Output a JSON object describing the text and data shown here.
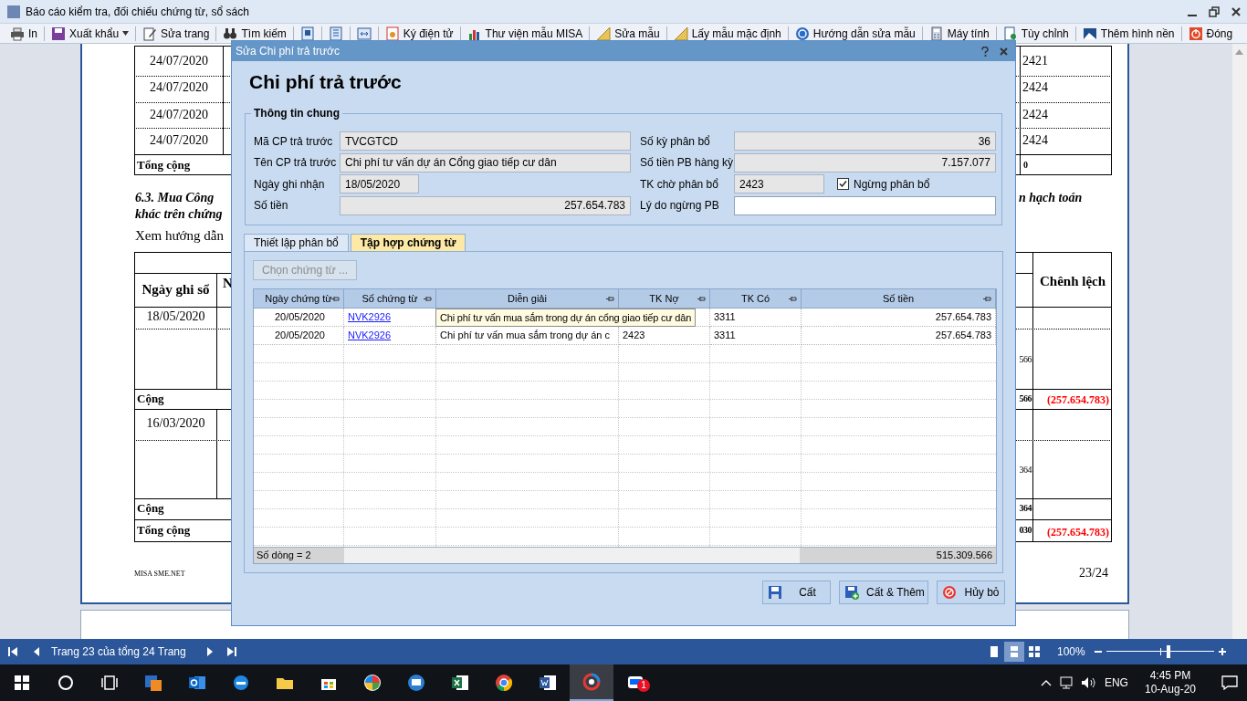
{
  "window": {
    "title": "Báo cáo kiểm tra, đối chiếu chứng từ, sổ sách"
  },
  "toolbar": [
    {
      "kind": "print",
      "label": "In",
      "dropdown": false
    },
    {
      "kind": "export",
      "label": "Xuất khẩu",
      "dropdown": true
    },
    {
      "kind": "edit",
      "label": "Sửa trang",
      "dropdown": false
    },
    {
      "kind": "find",
      "label": "Tìm kiếm",
      "dropdown": false
    },
    {
      "kind": "page-single",
      "dropdown": false
    },
    {
      "kind": "page-double",
      "dropdown": false
    },
    {
      "kind": "page-fit",
      "dropdown": false
    },
    {
      "kind": "sign",
      "label": "Ký điện tử",
      "dropdown": false
    },
    {
      "kind": "library",
      "label": "Thư viện mẫu MISA",
      "dropdown": false
    },
    {
      "kind": "template",
      "label": "Sửa mẫu",
      "dropdown": false
    },
    {
      "kind": "template",
      "label": "Lấy mẫu mặc định",
      "dropdown": false
    },
    {
      "kind": "help",
      "label": "Hướng dẫn sửa mẫu",
      "dropdown": false
    },
    {
      "kind": "calculator",
      "label": "Máy tính",
      "dropdown": false
    },
    {
      "kind": "customize",
      "label": "Tùy chỉnh",
      "dropdown": false
    },
    {
      "kind": "wallpaper",
      "label": "Thêm hình nền",
      "dropdown": false
    },
    {
      "kind": "close",
      "label": "Đóng",
      "dropdown": false
    }
  ],
  "document": {
    "left": [
      {
        "kind": "cell",
        "text": "24/07/2020"
      },
      {
        "kind": "cell",
        "text": "24/07/2020"
      },
      {
        "kind": "cell",
        "text": "24/07/2020"
      },
      {
        "kind": "cell",
        "text": "24/07/2020"
      },
      {
        "kind": "total",
        "text": "Tổng cộng"
      },
      {
        "kind": "heading",
        "text": "6.3. Mua Công"
      },
      {
        "kind": "heading",
        "text": "khác trên chứng"
      },
      {
        "kind": "para",
        "text": "Xem hướng dẫn"
      },
      {
        "kind": "header",
        "text": "Ngày ghi sổ"
      },
      {
        "kind": "header",
        "text": "N"
      },
      {
        "kind": "cell",
        "text": "18/05/2020"
      },
      {
        "kind": "total",
        "text": "Cộng"
      },
      {
        "kind": "cell",
        "text": "16/03/2020"
      },
      {
        "kind": "total",
        "text": "Cộng"
      },
      {
        "kind": "total",
        "text": "Tổng cộng"
      },
      {
        "kind": "footer",
        "text": "MISA SME.NET"
      }
    ],
    "right": [
      {
        "kind": "cell",
        "text": "2421"
      },
      {
        "kind": "cell",
        "text": "2424"
      },
      {
        "kind": "cell",
        "text": "2424"
      },
      {
        "kind": "cell",
        "text": "2424"
      },
      {
        "kind": "number-total",
        "text": "0"
      },
      {
        "kind": "heading",
        "text": "n hạch toán"
      },
      {
        "kind": "header",
        "text": "Chênh lệch"
      },
      {
        "kind": "number",
        "text": "566"
      },
      {
        "kind": "number-total",
        "text": "566"
      },
      {
        "kind": "negative",
        "text": "(257.654.783)"
      },
      {
        "kind": "number",
        "text": "364"
      },
      {
        "kind": "number-total",
        "text": "364"
      },
      {
        "kind": "number-total",
        "text": "030"
      },
      {
        "kind": "negative",
        "text": "(257.654.783)"
      },
      {
        "kind": "page",
        "text": "23/24"
      }
    ]
  },
  "dialog": {
    "title": "Sửa Chi phí trả trước",
    "heading": "Chi phí trả trước",
    "group": "Thông tin chung",
    "left_fields": [
      {
        "label": "Mã CP trả trước",
        "kind": "text",
        "value": "TVCGTCD",
        "readonly": true
      },
      {
        "label": "Tên CP trả trước",
        "kind": "text",
        "value": "Chi phí tư vấn dự án Cổng giao tiếp cư dân",
        "readonly": true
      },
      {
        "label": "Ngày ghi nhận",
        "kind": "date",
        "value": "18/05/2020",
        "readonly": true
      },
      {
        "label": "Số tiền",
        "kind": "number",
        "value": "257.654.783",
        "readonly": true
      }
    ],
    "right_fields": [
      {
        "label": "Số kỳ phân bổ",
        "kind": "number",
        "value": "36",
        "readonly": true
      },
      {
        "label": "Số tiền PB hàng kỳ",
        "kind": "number",
        "value": "7.157.077",
        "readonly": true
      },
      {
        "label": "TK chờ phân bổ",
        "kind": "code",
        "value": "2423",
        "readonly": true
      },
      {
        "label": "Lý do ngừng PB",
        "kind": "text",
        "readonly": false
      }
    ],
    "stop_allocation": {
      "label": "Ngừng phân bổ",
      "checked": true
    },
    "tabs": [
      {
        "label": "Thiết lập phân bổ",
        "selected": false
      },
      {
        "label": "Tập hợp chứng từ",
        "selected": true
      }
    ],
    "choose_button": {
      "label": "Chọn chứng từ ...",
      "disabled": true
    },
    "grid": {
      "columns": [
        "Ngày chứng từ",
        "Số chứng từ",
        "Diễn giải",
        "TK Nợ",
        "TK Có",
        "Số tiền"
      ],
      "rows": [
        {
          "date": "20/05/2020",
          "voucher": "NVK2926",
          "credit": "3311",
          "amount": "257.654.783"
        },
        {
          "date": "20/05/2020",
          "voucher": "NVK2926",
          "description": "Chi phí tư vấn mua sắm trong dự án c",
          "debit": "2423",
          "credit": "3311",
          "amount": "257.654.783"
        }
      ],
      "tooltip": "Chi phí tư vấn mua sắm trong dự án cổng giao tiếp cư dân",
      "footer": {
        "count": "Số dòng = 2",
        "total": "515.309.566"
      }
    },
    "buttons": [
      {
        "kind": "save",
        "label": "Cất"
      },
      {
        "kind": "save-add",
        "label": "Cất & Thêm"
      },
      {
        "kind": "cancel",
        "label": "Hủy bỏ"
      }
    ]
  },
  "status_bar": {
    "page_info": "Trang 23 của tổng 24 Trang",
    "views": [
      {
        "kind": "single",
        "selected": false
      },
      {
        "kind": "double",
        "selected": true
      },
      {
        "kind": "multi",
        "selected": false
      }
    ],
    "zoom": "100%",
    "level": 0.58
  },
  "taskbar": {
    "apps": [
      {
        "kind": "start",
        "selected": false
      },
      {
        "kind": "search",
        "selected": false
      },
      {
        "kind": "taskview",
        "selected": false
      },
      {
        "kind": "misa",
        "selected": false
      },
      {
        "kind": "outlook",
        "selected": false
      },
      {
        "kind": "edge",
        "selected": false
      },
      {
        "kind": "folder",
        "selected": false
      },
      {
        "kind": "store",
        "selected": false
      },
      {
        "kind": "pinwheel",
        "selected": false
      },
      {
        "kind": "remote",
        "selected": false
      },
      {
        "kind": "excel",
        "selected": false
      },
      {
        "kind": "chrome",
        "selected": false
      },
      {
        "kind": "word",
        "selected": false
      },
      {
        "kind": "ring",
        "selected": true
      },
      {
        "kind": "chat",
        "selected": false,
        "badge": "1"
      }
    ],
    "language": "ENG",
    "time": "4:45 PM",
    "date": "10-Aug-20"
  }
}
